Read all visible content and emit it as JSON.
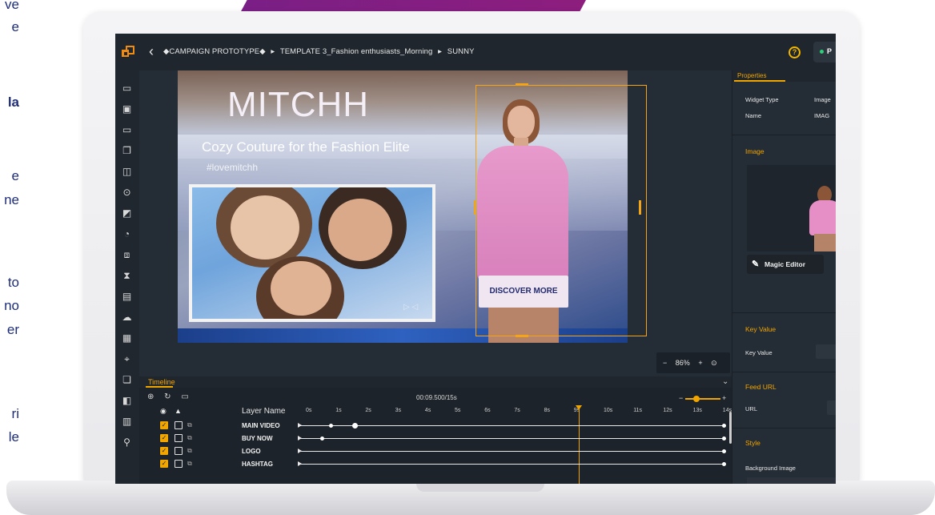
{
  "page_side_text": [
    "ve",
    "e",
    "la",
    "e",
    "ne",
    "to",
    "no",
    "er",
    "ri",
    "le"
  ],
  "app": {
    "breadcrumb": [
      "◆CAMPAIGN PROTOTYPE◆",
      "TEMPLATE 3_Fashion enthusiasts_Morning",
      "SUNNY"
    ],
    "breadcrumb_separator": "▸",
    "publish_label": "P"
  },
  "creative": {
    "brand": "MITCHH",
    "tagline": "Cozy Couture for the Fashion Elite",
    "hashtag": "#lovemitchh",
    "cta_label": "DISCOVER MORE"
  },
  "zoom": {
    "minus": "−",
    "value": "86%",
    "plus": "+",
    "reset": "⊙"
  },
  "timeline": {
    "tab_label": "Timeline",
    "current_time": "00:09.500/15s",
    "layer_header": "Layer Name",
    "ticks": [
      "0s",
      "1s",
      "2s",
      "3s",
      "4s",
      "5s",
      "6s",
      "7s",
      "8s",
      "9s",
      "10s",
      "11s",
      "12s",
      "13s",
      "14s"
    ],
    "playhead_seconds": 9,
    "layers": [
      {
        "name": "MAIN VIDEO",
        "keyframes": [
          0.8,
          1.6,
          14
        ]
      },
      {
        "name": "BUY NOW",
        "keyframes": [
          0.5,
          14
        ]
      },
      {
        "name": "LOGO",
        "keyframes": [
          14
        ]
      },
      {
        "name": "HASHTAG",
        "keyframes": [
          14
        ]
      }
    ]
  },
  "properties": {
    "tab_label": "Properties",
    "widget_type_label": "Widget Type",
    "widget_type_value": "Image",
    "name_label": "Name",
    "name_value": "IMAG",
    "image_section": "Image",
    "magic_editor_label": "Magic Editor",
    "key_value_section": "Key Value",
    "key_value_label": "Key Value",
    "feed_url_section": "Feed URL",
    "url_label": "URL",
    "style_section": "Style",
    "background_image_label": "Background Image"
  },
  "colors": {
    "accent": "#f0a500",
    "ribbon": "#7a1f86",
    "panel": "#242c35",
    "cta_text": "#232a6e"
  }
}
